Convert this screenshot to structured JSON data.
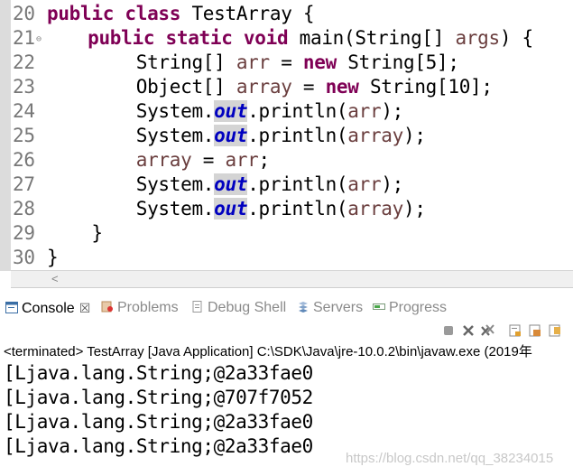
{
  "editor": {
    "lines": [
      {
        "n": "20",
        "segs": [
          {
            "t": "public",
            "c": "kw"
          },
          {
            "t": " "
          },
          {
            "t": "class",
            "c": "kw"
          },
          {
            "t": " TestArray {"
          }
        ]
      },
      {
        "n": "21",
        "fold": "⊖",
        "segs": [
          {
            "t": "    "
          },
          {
            "t": "public",
            "c": "kw"
          },
          {
            "t": " "
          },
          {
            "t": "static",
            "c": "kw"
          },
          {
            "t": " "
          },
          {
            "t": "void",
            "c": "kw"
          },
          {
            "t": " main(String[] "
          },
          {
            "t": "args",
            "c": "var"
          },
          {
            "t": ") {"
          }
        ]
      },
      {
        "n": "22",
        "segs": [
          {
            "t": "        String[] "
          },
          {
            "t": "arr",
            "c": "var"
          },
          {
            "t": " = "
          },
          {
            "t": "new",
            "c": "kw"
          },
          {
            "t": " String[5];"
          }
        ]
      },
      {
        "n": "23",
        "segs": [
          {
            "t": "        Object[] "
          },
          {
            "t": "array",
            "c": "var"
          },
          {
            "t": " = "
          },
          {
            "t": "new",
            "c": "kw"
          },
          {
            "t": " String[10];"
          }
        ]
      },
      {
        "n": "24",
        "segs": [
          {
            "t": "        System."
          },
          {
            "t": "out",
            "c": "fld"
          },
          {
            "t": ".println("
          },
          {
            "t": "arr",
            "c": "var"
          },
          {
            "t": ");"
          }
        ]
      },
      {
        "n": "25",
        "segs": [
          {
            "t": "        System."
          },
          {
            "t": "out",
            "c": "fld"
          },
          {
            "t": ".println("
          },
          {
            "t": "array",
            "c": "var"
          },
          {
            "t": ");"
          }
        ]
      },
      {
        "n": "26",
        "segs": [
          {
            "t": "        "
          },
          {
            "t": "array",
            "c": "var"
          },
          {
            "t": " = "
          },
          {
            "t": "arr",
            "c": "var"
          },
          {
            "t": ";"
          }
        ]
      },
      {
        "n": "27",
        "segs": [
          {
            "t": "        System."
          },
          {
            "t": "out",
            "c": "fld"
          },
          {
            "t": ".println("
          },
          {
            "t": "arr",
            "c": "var"
          },
          {
            "t": ");"
          }
        ]
      },
      {
        "n": "28",
        "segs": [
          {
            "t": "        System."
          },
          {
            "t": "out",
            "c": "fld"
          },
          {
            "t": ".println("
          },
          {
            "t": "array",
            "c": "var"
          },
          {
            "t": ");"
          }
        ]
      },
      {
        "n": "29",
        "segs": [
          {
            "t": "    }"
          }
        ]
      },
      {
        "n": "30",
        "segs": [
          {
            "t": "}"
          }
        ]
      }
    ],
    "scroll_left_glyph": "<"
  },
  "console": {
    "tabs": [
      {
        "label": "Console",
        "close": "☒",
        "icon": "console-icon",
        "active": true
      },
      {
        "label": "Problems",
        "icon": "problems-icon"
      },
      {
        "label": "Debug Shell",
        "icon": "debug-shell-icon"
      },
      {
        "label": "Servers",
        "icon": "servers-icon"
      },
      {
        "label": "Progress",
        "icon": "progress-icon"
      }
    ],
    "toolbar_icons": [
      "terminate-icon",
      "remove-launch-icon",
      "remove-all-icon",
      "scroll-lock-icon",
      "pin-console-icon",
      "open-console-icon"
    ],
    "status": "<terminated> TestArray [Java Application] C:\\SDK\\Java\\jre-10.0.2\\bin\\javaw.exe (2019年",
    "output": [
      "[Ljava.lang.String;@2a33fae0",
      "[Ljava.lang.String;@707f7052",
      "[Ljava.lang.String;@2a33fae0",
      "[Ljava.lang.String;@2a33fae0"
    ]
  },
  "watermark": "https://blog.csdn.net/qq_38234015",
  "colors": {
    "keyword": "#7f0055",
    "field": "#0000c0",
    "variable": "#6a3e3e"
  }
}
